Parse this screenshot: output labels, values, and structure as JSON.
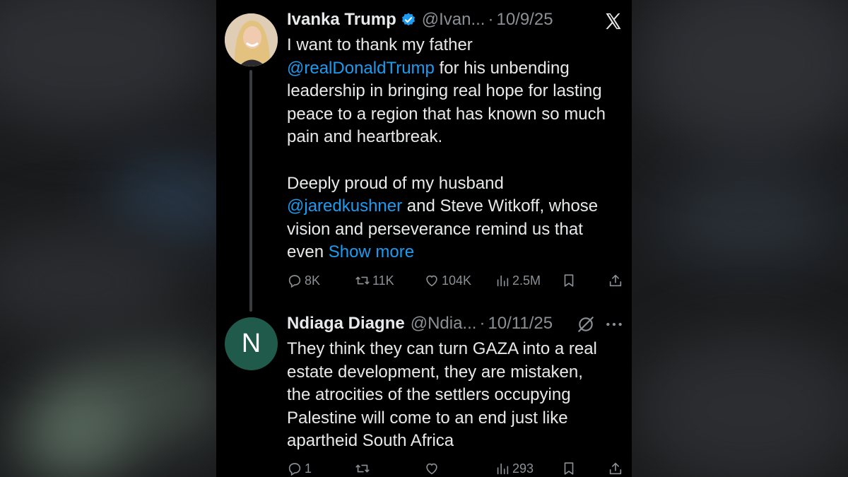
{
  "tweet": {
    "author_name": "Ivanka Trump",
    "handle": "@Ivan...",
    "separator": "·",
    "date": "10/9/25",
    "text_lines": [
      "I want to thank my father",
      "@realDonaldTrump",
      " for his unbending",
      "leadership in bringing real hope for lasting",
      "peace to a region that has known so much",
      "pain and heartbreak."
    ],
    "text_lines_2": [
      "Deeply proud of my husband",
      "@jaredkushner",
      " and Steve Witkoff, whose",
      "vision and perseverance remind us that",
      "even ",
      "Show more"
    ],
    "stats": {
      "replies": "8K",
      "reposts": "11K",
      "likes": "104K",
      "views": "2.5M"
    }
  },
  "reply": {
    "avatar_letter": "N",
    "author_name": "Ndiaga Diagne",
    "handle": "@Ndia...",
    "separator": "·",
    "date": "10/11/25",
    "text_lines": [
      "They think they can turn GAZA into a real",
      "estate development, they are mistaken,",
      "the atrocities of the settlers occupying",
      "Palestine will come to an end just like",
      "apartheid South Africa"
    ],
    "stats": {
      "replies": "1",
      "reposts": "",
      "likes": "",
      "views": "293"
    }
  },
  "icons": {
    "close": "x-logo-icon",
    "verified": "verified-badge-icon",
    "grok": "grok-icon",
    "more": "more-icon",
    "reply": "reply-icon",
    "repost": "repost-icon",
    "like": "heart-icon",
    "views": "views-icon",
    "bookmark": "bookmark-icon",
    "share": "share-icon"
  },
  "colors": {
    "background": "#000000",
    "text": "#e7e9ea",
    "muted": "#8b9095",
    "link": "#1d9bf0",
    "reply_avatar": "#1f5a4a"
  }
}
